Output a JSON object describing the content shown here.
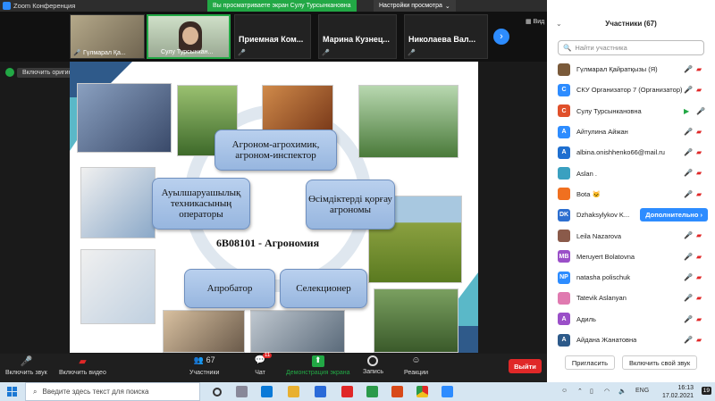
{
  "app": {
    "title": "Zoom Конференция",
    "sharing_banner": "Вы просматриваете экран Сулу Турсынкановна",
    "view_options": "Настройки просмотра",
    "view_label": "Вид"
  },
  "gallery": {
    "tiles": [
      {
        "name": "Гүлмарал Қа..."
      },
      {
        "name": "Сулу Турсынкан..."
      },
      {
        "name": "Приемная  Ком..."
      },
      {
        "name": "Марина  Кузнец..."
      },
      {
        "name": "Николаева  Вал..."
      }
    ]
  },
  "original_sound": {
    "label": "Включить оригинальный звук"
  },
  "slide": {
    "boxes": [
      "Агроном-агрохимик, агроном-инспектор",
      "Ауылшаруашылық техникасының операторы",
      "Өсімдіктерді қорғау агрономы",
      "Апробатор",
      "Селекционер"
    ],
    "program": "6В08101 - Агрономия"
  },
  "toolbar": {
    "unmute": "Включить звук",
    "start_video": "Включить видео",
    "participants": "Участники",
    "participants_count": "67",
    "chat": "Чат",
    "chat_badge": "11",
    "share": "Демонстрация экрана",
    "record": "Запись",
    "reactions": "Реакции",
    "leave": "Выйти"
  },
  "participants_panel": {
    "title": "Участники (67)",
    "search_placeholder": "Найти участника",
    "people": [
      {
        "name": "Гүлмарал Қайратқызы (Я)",
        "avatar": "photo",
        "color": "#7a5a3a"
      },
      {
        "name": "СКУ Организатор 7 (Организатор)",
        "avatar": "С",
        "color": "#2d8cff"
      },
      {
        "name": "Сулу Турсынкановна",
        "avatar": "С",
        "color": "#e0502a",
        "video_on": true
      },
      {
        "name": "Айтулина Айжан",
        "avatar": "А",
        "color": "#2d8cff"
      },
      {
        "name": "albina.onishhenko66@mail.ru",
        "avatar": "A",
        "color": "#1f6fd0"
      },
      {
        "name": "Aslan .",
        "avatar": "photo",
        "color": "#3aa0c0"
      },
      {
        "name": "Bota 🐱",
        "avatar": "photo",
        "color": "#f07020"
      },
      {
        "name": "Dzhaksylykov K...",
        "avatar": "DK",
        "color": "#2d6fd0",
        "more": "Дополнительно ›"
      },
      {
        "name": "Leila Nazarova",
        "avatar": "photo",
        "color": "#8a5a4a"
      },
      {
        "name": "Meruyert Bolatovna",
        "avatar": "MB",
        "color": "#9a4fc8"
      },
      {
        "name": "natasha polischuk",
        "avatar": "NP",
        "color": "#2d8cff"
      },
      {
        "name": "Tatevik Aslanyan",
        "avatar": "photo",
        "color": "#e07ab0"
      },
      {
        "name": "Адиль",
        "avatar": "А",
        "color": "#9a4fc8"
      },
      {
        "name": "Айдана Жанатовна",
        "avatar": "А",
        "color": "#2d5a8a"
      }
    ],
    "invite": "Пригласить",
    "unmute_self": "Включить свой звук"
  },
  "taskbar": {
    "search_placeholder": "Введите здесь текст для поиска",
    "lang": "ENG",
    "time": "16:13",
    "date": "17.02.2021",
    "notif_count": "19"
  }
}
